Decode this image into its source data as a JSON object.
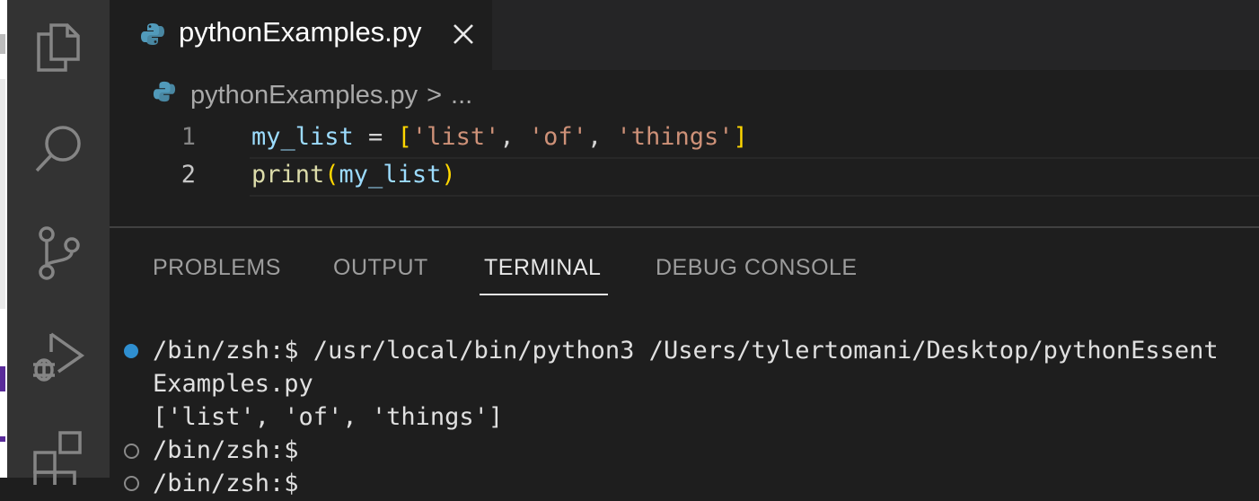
{
  "tab": {
    "filename": "pythonExamples.py",
    "close_icon": "close-icon",
    "file_icon": "python-icon"
  },
  "breadcrumb": {
    "file": "pythonExamples.py",
    "separator": ">",
    "more": "..."
  },
  "editor": {
    "lines": [
      {
        "number": "1",
        "tokens": {
          "var": "my_list",
          "op": " = ",
          "open": "[",
          "s1": "'list'",
          "c1": ", ",
          "s2": "'of'",
          "c2": ", ",
          "s3": "'things'",
          "close": "]"
        }
      },
      {
        "number": "2",
        "tokens": {
          "fn": "print",
          "open": "(",
          "arg": "my_list",
          "close": ")"
        }
      }
    ]
  },
  "activity_bar": {
    "icons": [
      "explorer-icon",
      "search-icon",
      "source-control-icon",
      "run-debug-icon",
      "extensions-icon"
    ]
  },
  "panel": {
    "tabs": [
      "PROBLEMS",
      "OUTPUT",
      "TERMINAL",
      "DEBUG CONSOLE"
    ],
    "active_tab": "TERMINAL"
  },
  "terminal": {
    "lines": [
      "/bin/zsh:$ /usr/local/bin/python3 /Users/tylertomani/Desktop/pythonEssent",
      "Examples.py",
      "['list', 'of', 'things']",
      "/bin/zsh:$",
      "/bin/zsh:$"
    ]
  },
  "colors": {
    "activity_bar": "#333333",
    "editor_bg": "#1e1e1e",
    "tab_bar_bg": "#252526",
    "string": "#ce9178",
    "variable": "#9cdcfe",
    "function": "#dcdcaa",
    "bracket": "#ffd700",
    "terminal_dot": "#2f8fd0"
  }
}
